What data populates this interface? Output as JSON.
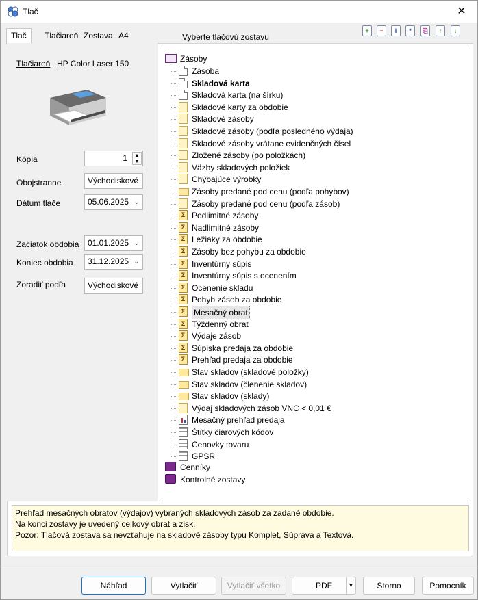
{
  "window": {
    "title": "Tlač",
    "close": "✕"
  },
  "tabs": [
    {
      "label": "Tlač"
    },
    {
      "label": "Tlačiareň"
    },
    {
      "label": "Zostava"
    },
    {
      "label": "A4"
    }
  ],
  "toolbar": {
    "title": "Vyberte tlačovú zostavu",
    "icons": [
      "+",
      "−",
      "i",
      "*",
      "⎘",
      "↑",
      "↓"
    ]
  },
  "printer": {
    "link_label": "Tlačiareň",
    "name": "HP Color Laser 150"
  },
  "form": {
    "copies": {
      "label": "Kópia",
      "value": "1"
    },
    "duplex": {
      "label": "Obojstranne",
      "value": "Východiskové"
    },
    "print_date": {
      "label": "Dátum tlače",
      "value": "05.06.2025"
    },
    "period_start": {
      "label": "Začiatok obdobia",
      "value": "01.01.2025"
    },
    "period_end": {
      "label": "Koniec obdobia",
      "value": "31.12.2025"
    },
    "sort_by": {
      "label": "Zoradiť podľa",
      "value": "Východiskové"
    }
  },
  "tree": {
    "root": "Zásoby",
    "items": [
      {
        "label": "Zásoba",
        "icon": "doc"
      },
      {
        "label": "Skladová karta",
        "icon": "doc",
        "bold": true
      },
      {
        "label": "Skladová karta (na šírku)",
        "icon": "doc"
      },
      {
        "label": "Skladové karty za obdobie",
        "icon": "yellow-doc"
      },
      {
        "label": "Skladové zásoby",
        "icon": "yellow-doc"
      },
      {
        "label": "Skladové zásoby (podľa posledného výdaja)",
        "icon": "yellow-doc"
      },
      {
        "label": "Skladové zásoby vrátane evidenčných čísel",
        "icon": "yellow-doc"
      },
      {
        "label": "Zložené zásoby (po položkách)",
        "icon": "yellow-doc"
      },
      {
        "label": "Väzby skladových položiek",
        "icon": "yellow-doc"
      },
      {
        "label": "Chýbajúce výrobky",
        "icon": "yellow-doc"
      },
      {
        "label": "Zásoby predané pod cenu (podľa pohybov)",
        "icon": "folder"
      },
      {
        "label": "Zásoby predané pod cenu (podľa zásob)",
        "icon": "yellow-doc"
      },
      {
        "label": "Podlimitné zásoby",
        "icon": "sigma"
      },
      {
        "label": "Nadlimitné zásoby",
        "icon": "sigma"
      },
      {
        "label": "Ležiaky za obdobie",
        "icon": "sigma"
      },
      {
        "label": "Zásoby bez pohybu za obdobie",
        "icon": "sigma"
      },
      {
        "label": "Inventúrny súpis",
        "icon": "sigma"
      },
      {
        "label": "Inventúrny súpis s ocenením",
        "icon": "sigma"
      },
      {
        "label": "Ocenenie skladu",
        "icon": "sigma"
      },
      {
        "label": "Pohyb zásob za obdobie",
        "icon": "sigma"
      },
      {
        "label": "Mesačný obrat",
        "icon": "sigma",
        "selected": true
      },
      {
        "label": "Týždenný obrat",
        "icon": "sigma"
      },
      {
        "label": "Výdaje zásob",
        "icon": "sigma"
      },
      {
        "label": "Súpiska predaja za obdobie",
        "icon": "sigma"
      },
      {
        "label": "Prehľad predaja za obdobie",
        "icon": "sigma"
      },
      {
        "label": "Stav skladov (skladové položky)",
        "icon": "folder"
      },
      {
        "label": "Stav skladov (členenie skladov)",
        "icon": "folder"
      },
      {
        "label": "Stav skladov (sklady)",
        "icon": "folder"
      },
      {
        "label": "Výdaj skladových zásob VNC < 0,01 €",
        "icon": "yellow-doc"
      },
      {
        "label": "Mesačný prehľad predaja",
        "icon": "chart"
      },
      {
        "label": "Štítky čiarových kódov",
        "icon": "grid"
      },
      {
        "label": "Cenovky tovaru",
        "icon": "grid"
      },
      {
        "label": "GPSR",
        "icon": "grid"
      }
    ],
    "siblings": [
      {
        "label": "Cenníky"
      },
      {
        "label": "Kontrolné zostavy"
      }
    ]
  },
  "info": {
    "lines": [
      "Prehľad mesačných obratov (výdajov) vybraných skladových zásob za zadané obdobie.",
      "Na konci zostavy je uvedený celkový obrat a zisk.",
      "Pozor: Tlačová zostava sa nevzťahuje na skladové zásoby typu Komplet, Súprava a Textová."
    ]
  },
  "buttons": {
    "preview": "Náhľad",
    "print": "Vytlačiť",
    "print_all": "Vytlačiť všetko",
    "pdf": "PDF",
    "cancel": "Storno",
    "help": "Pomocník"
  }
}
